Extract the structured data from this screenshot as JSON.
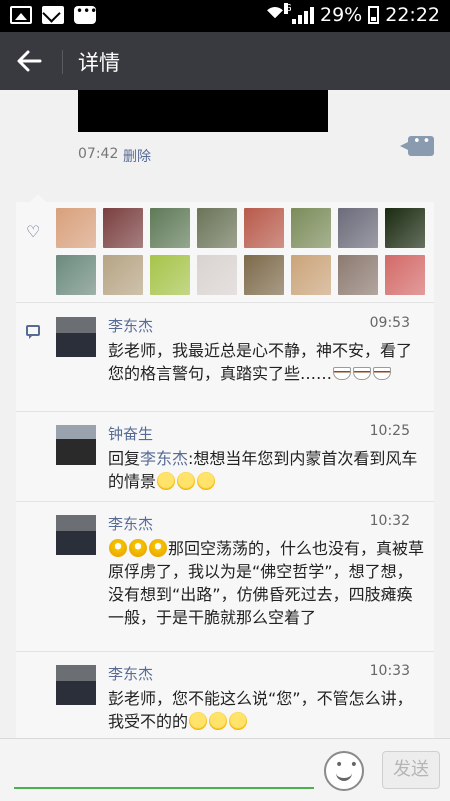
{
  "status_bar": {
    "network_type": "G",
    "battery": "29%",
    "clock": "22:22"
  },
  "title_bar": {
    "title": "详情"
  },
  "post": {
    "time": "07:42",
    "delete_label": "删除"
  },
  "likes": {
    "icon": "heart-icon",
    "avatar_colors": [
      "#d8a07c",
      "#7a3f3f",
      "#5f7a57",
      "#6b7458",
      "#b85a4a",
      "#7b8c5a",
      "#6b6b7a",
      "#1a2a10",
      "#6c8a7d",
      "#b6a484",
      "#a6c44a",
      "#d9d2d0",
      "#7d6a4a",
      "#caa47a",
      "#8c7a70",
      "#d36a68"
    ]
  },
  "comments": [
    {
      "name": "李东杰",
      "time": "09:53",
      "text": "彭老师，我最近总是心不静，神不安，看了您的格言警句，真踏实了些……",
      "emoji": "cup",
      "emoji_count": 3
    },
    {
      "name": "钟奋生",
      "time": "10:25",
      "reply_prefix": "回复",
      "reply_to": "李东杰",
      "text": ":想想当年您到内蒙首次看到风车的情景",
      "emoji": "smile",
      "emoji_count": 3
    },
    {
      "name": "李东杰",
      "time": "10:32",
      "text": "那回空荡荡的，什么也没有，真被草原俘虏了，我以为是“佛空哲学”，想了想，没有想到“出路”，仿佛昏死过去，四肢瘫痪一般，于是干脆就那么空着了",
      "emoji": "grin",
      "emoji_count": 3
    },
    {
      "name": "李东杰",
      "time": "10:33",
      "text": "彭老师，您不能这么说“您”，不管怎么讲，我受不的的",
      "emoji": "smile",
      "emoji_count": 3
    }
  ],
  "input_bar": {
    "send_label": "发送",
    "input_value": ""
  }
}
